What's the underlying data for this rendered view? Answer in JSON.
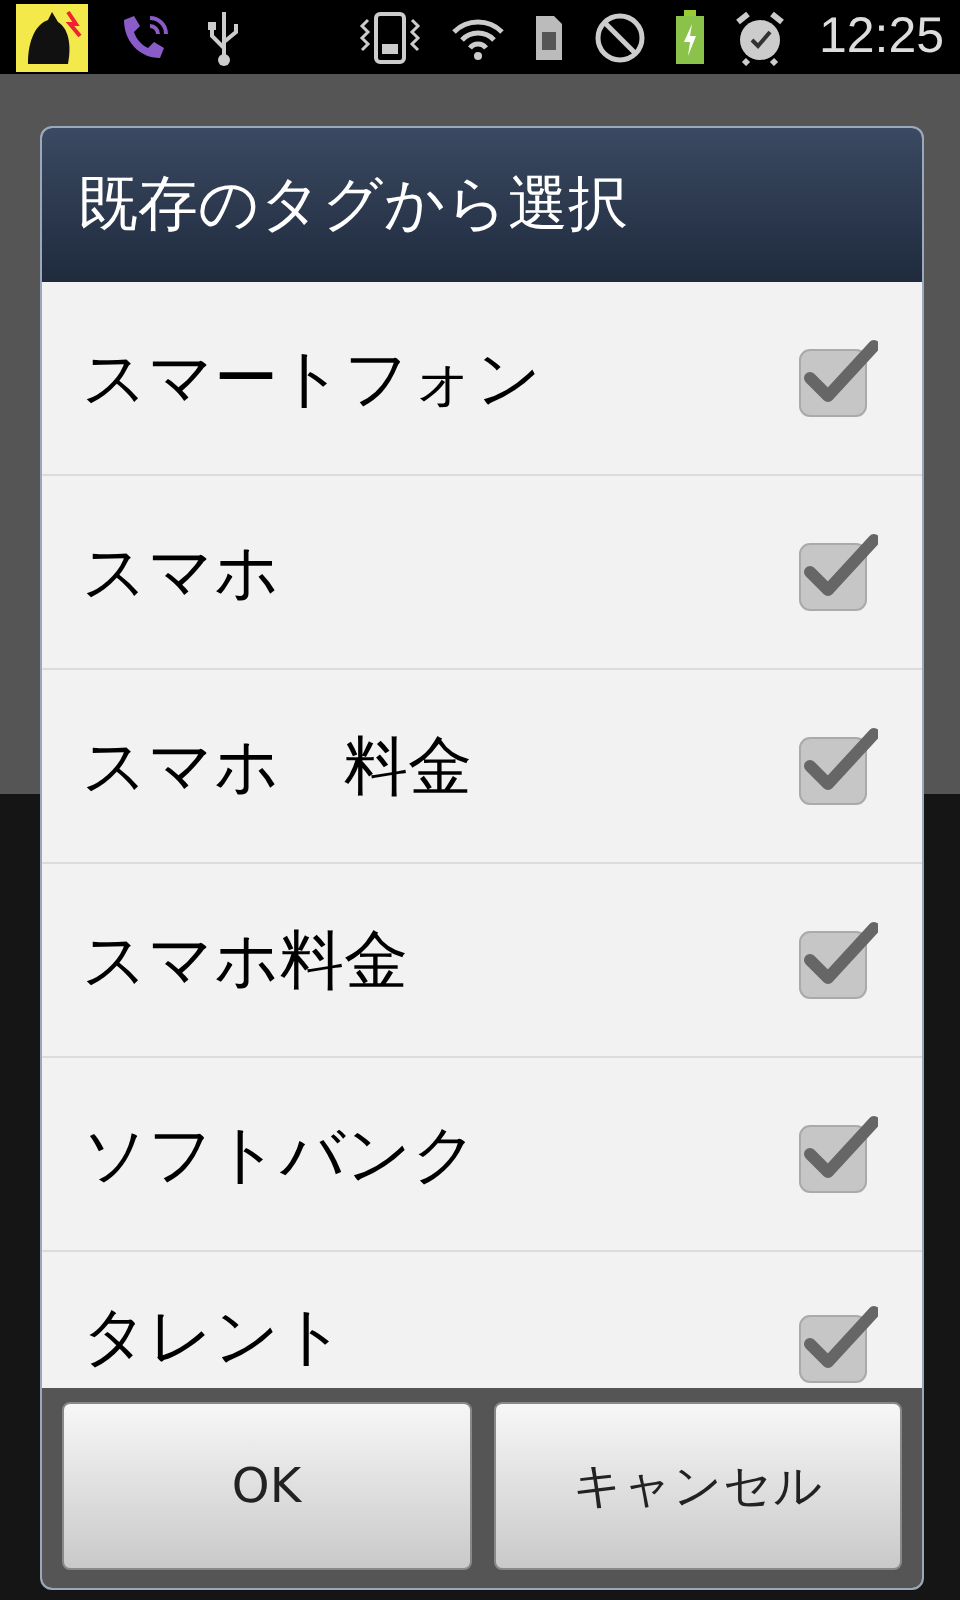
{
  "status_bar": {
    "time": "12:25"
  },
  "dialog": {
    "title": "既存のタグから選択",
    "items": [
      {
        "label": "スマートフォン",
        "checked": true
      },
      {
        "label": "スマホ",
        "checked": true
      },
      {
        "label": "スマホ　料金",
        "checked": true
      },
      {
        "label": "スマホ料金",
        "checked": true
      },
      {
        "label": "ソフトバンク",
        "checked": true
      },
      {
        "label": "タレント",
        "checked": true
      }
    ],
    "buttons": [
      {
        "label": "OK"
      },
      {
        "label": "キャンセル"
      }
    ]
  }
}
